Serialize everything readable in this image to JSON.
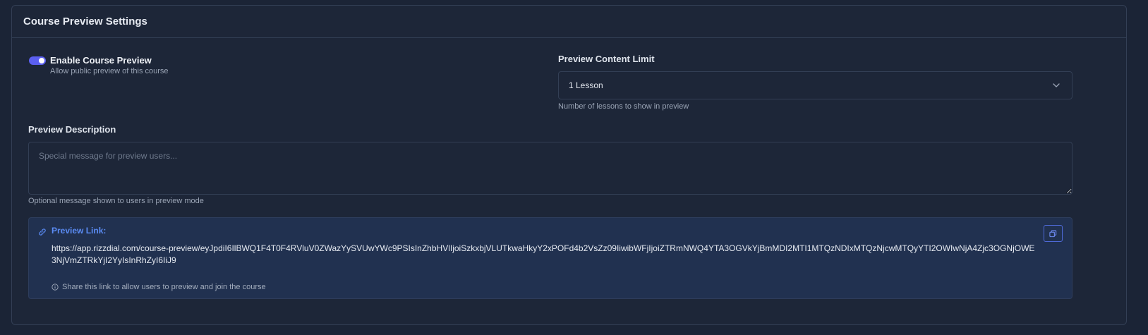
{
  "header": {
    "title": "Course Preview Settings"
  },
  "enable_preview": {
    "label": "Enable Course Preview",
    "help": "Allow public preview of this course",
    "checked": true
  },
  "content_limit": {
    "label": "Preview Content Limit",
    "selected": "1 Lesson",
    "help": "Number of lessons to show in preview"
  },
  "description": {
    "label": "Preview Description",
    "placeholder": "Special message for preview users...",
    "value": "",
    "help": "Optional message shown to users in preview mode"
  },
  "preview_link": {
    "title": "Preview Link:",
    "url": "https://app.rizzdial.com/course-preview/eyJpdiI6IlBWQ1F4T0F4RVluV0ZWazYySVUwYWc9PSIsInZhbHVlIjoiSzkxbjVLUTkwaHkyY2xPOFd4b2VsZz09IiwibWFjIjoiZTRmNWQ4YTA3OGVkYjBmMDI2MTI1MTQzNDIxMTQzNjcwMTQyYTI2OWIwNjA4Zjc3OGNjOWE3NjVmZTRkYjI2YyIsInRhZyI6IiJ9",
    "share_help": "Share this link to allow users to preview and join the course"
  },
  "icons": {
    "link": "link-icon",
    "copy": "copy-icon",
    "info": "info-icon",
    "chevron": "chevron-down-icon"
  },
  "colors": {
    "background": "#1b2436",
    "card": "#1d2638",
    "accent": "#5b5ff0",
    "link_accent": "#5b8cf5",
    "link_box": "#213150"
  }
}
